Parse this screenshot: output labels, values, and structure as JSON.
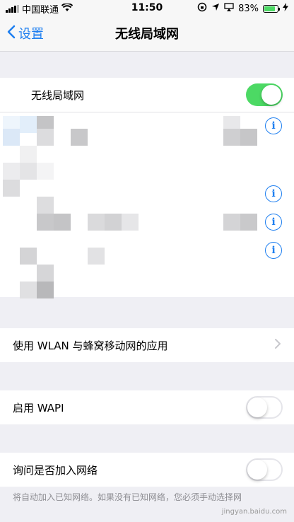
{
  "status_bar": {
    "carrier": "中国联通",
    "time": "11:50",
    "battery_percent": "83%",
    "battery_level": 0.83,
    "icons": [
      "signal-icon",
      "wifi-icon",
      "lock-rotation-icon",
      "location-icon",
      "airplay-icon",
      "battery-icon",
      "charging-icon"
    ]
  },
  "nav": {
    "back_label": "设置",
    "title": "无线局域网"
  },
  "wlan_row": {
    "label": "无线局域网",
    "toggle_on": true
  },
  "apps_row": {
    "label": "使用 WLAN 与蜂窝移动网的应用"
  },
  "wapi_row": {
    "label": "启用 WAPI",
    "toggle_on": false
  },
  "ask_row": {
    "label": "询问是否加入网络",
    "toggle_on": false
  },
  "footer_note": "将自动加入已知网络。如果没有已知网络，您必须手动选择网",
  "watermark": "jingyan.baidu.com",
  "colors": {
    "accent": "#1e7ff0",
    "toggle_on": "#4cd964",
    "background": "#efeff4"
  }
}
